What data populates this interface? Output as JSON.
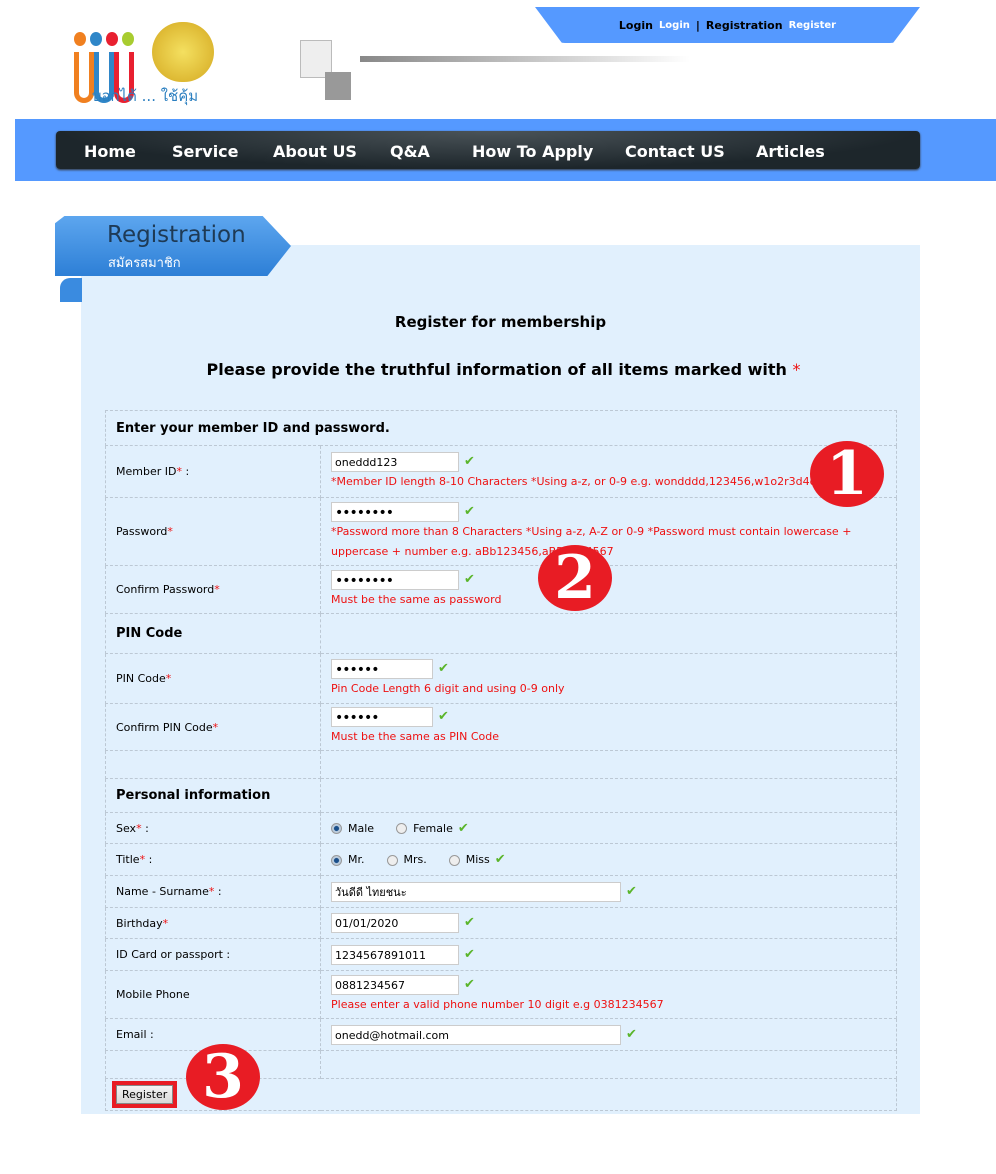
{
  "header": {
    "slogan": "บอกได้ ... ใช้คุ้ม",
    "login_label": "Login",
    "login_link": "Login",
    "separator": "|",
    "registration_label": "Registration",
    "register_link": "Register"
  },
  "nav": [
    "Home",
    "Service",
    "About US",
    "Q&A",
    "How To Apply",
    "Contact US",
    "Articles"
  ],
  "tab": {
    "title": "Registration",
    "subtitle": "สมัครสมาชิก"
  },
  "form": {
    "title": "Register for membership",
    "instruction": "Please provide the truthful information of all items marked with",
    "required_mark": "*",
    "section_account": "Enter your member ID and password.",
    "member_id": {
      "label": "Member ID",
      "suffix": " :",
      "value": "oneddd123",
      "hint": "*Member ID length 8-10 Characters *Using a-z, or 0-9 e.g. wondddd,123456,w1o2r3d4d5"
    },
    "password": {
      "label": "Password",
      "value": "••••••••",
      "hint": "*Password more than 8 Characters *Using a-z, A-Z or 0-9 *Password must contain lowercase + uppercase + number e.g. aBb123456,aBD1234567"
    },
    "confirm_password": {
      "label": "Confirm Password",
      "value": "••••••••",
      "hint": "Must be the same as password"
    },
    "section_pin": "PIN Code",
    "pin": {
      "label": "PIN Code",
      "value": "••••••",
      "hint": "Pin Code Length 6 digit and using 0-9 only"
    },
    "confirm_pin": {
      "label": "Confirm PIN Code",
      "value": "••••••",
      "hint": "Must be the same as PIN Code"
    },
    "section_personal": "Personal information",
    "sex": {
      "label": "Sex",
      "suffix": " :",
      "options": [
        "Male",
        "Female"
      ],
      "selected": "Male"
    },
    "title_field": {
      "label": "Title",
      "suffix": " :",
      "options": [
        "Mr.",
        "Mrs.",
        "Miss"
      ],
      "selected": "Mr."
    },
    "name": {
      "label": "Name - Surname",
      "suffix": " :",
      "value": "วันดีดี ไทยชนะ"
    },
    "birthday": {
      "label": "Birthday",
      "value": "01/01/2020"
    },
    "id_card": {
      "label": "ID Card or passport :",
      "value": "1234567891011"
    },
    "mobile": {
      "label": "Mobile Phone",
      "value": "0881234567",
      "hint": "Please enter a valid phone number 10 digit e.g 0381234567"
    },
    "email": {
      "label": "Email :",
      "value": "onedd@hotmail.com"
    },
    "submit": "Register"
  },
  "annotations": [
    "1",
    "2",
    "3"
  ],
  "colors": {
    "accent": "#5599ff",
    "error": "#ee1111",
    "annotation": "#e81c24",
    "panel": "#e1f0fd"
  }
}
